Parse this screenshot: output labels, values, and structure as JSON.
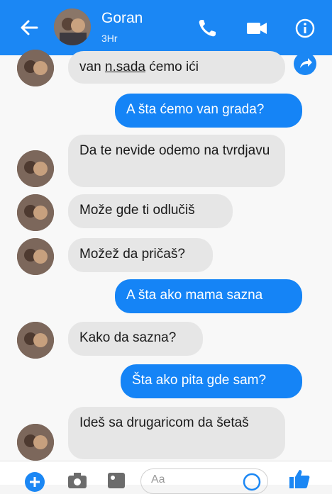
{
  "header": {
    "contact_name": "Goran",
    "status": "3Hr",
    "color": "#1b87f4"
  },
  "icons": [
    "back-arrow-icon",
    "phone-icon",
    "video-camera-icon",
    "info-icon",
    "share-icon",
    "add-icon",
    "camera-icon",
    "image-icon",
    "emoji-icon",
    "thumbs-up-icon"
  ],
  "messages": [
    {
      "side": "in",
      "text_pre": "van ",
      "text_underlined": "n.sada",
      "text_post": " ćemo ići"
    },
    {
      "side": "out",
      "text": "A šta ćemo van grada?"
    },
    {
      "side": "in",
      "text": "Da te nevide odemo na tvrdjavu"
    },
    {
      "side": "in",
      "text": "Može gde ti odlučiš"
    },
    {
      "side": "in",
      "text": "Možež da pričaš?"
    },
    {
      "side": "out",
      "text": "A šta ako mama sazna"
    },
    {
      "side": "in",
      "text": "Kako da sazna?"
    },
    {
      "side": "out",
      "text": "Šta ako pita gde sam?"
    },
    {
      "side": "in",
      "text": "Ideš sa drugaricom da šetaš"
    }
  ],
  "composer": {
    "placeholder": "Aa"
  }
}
